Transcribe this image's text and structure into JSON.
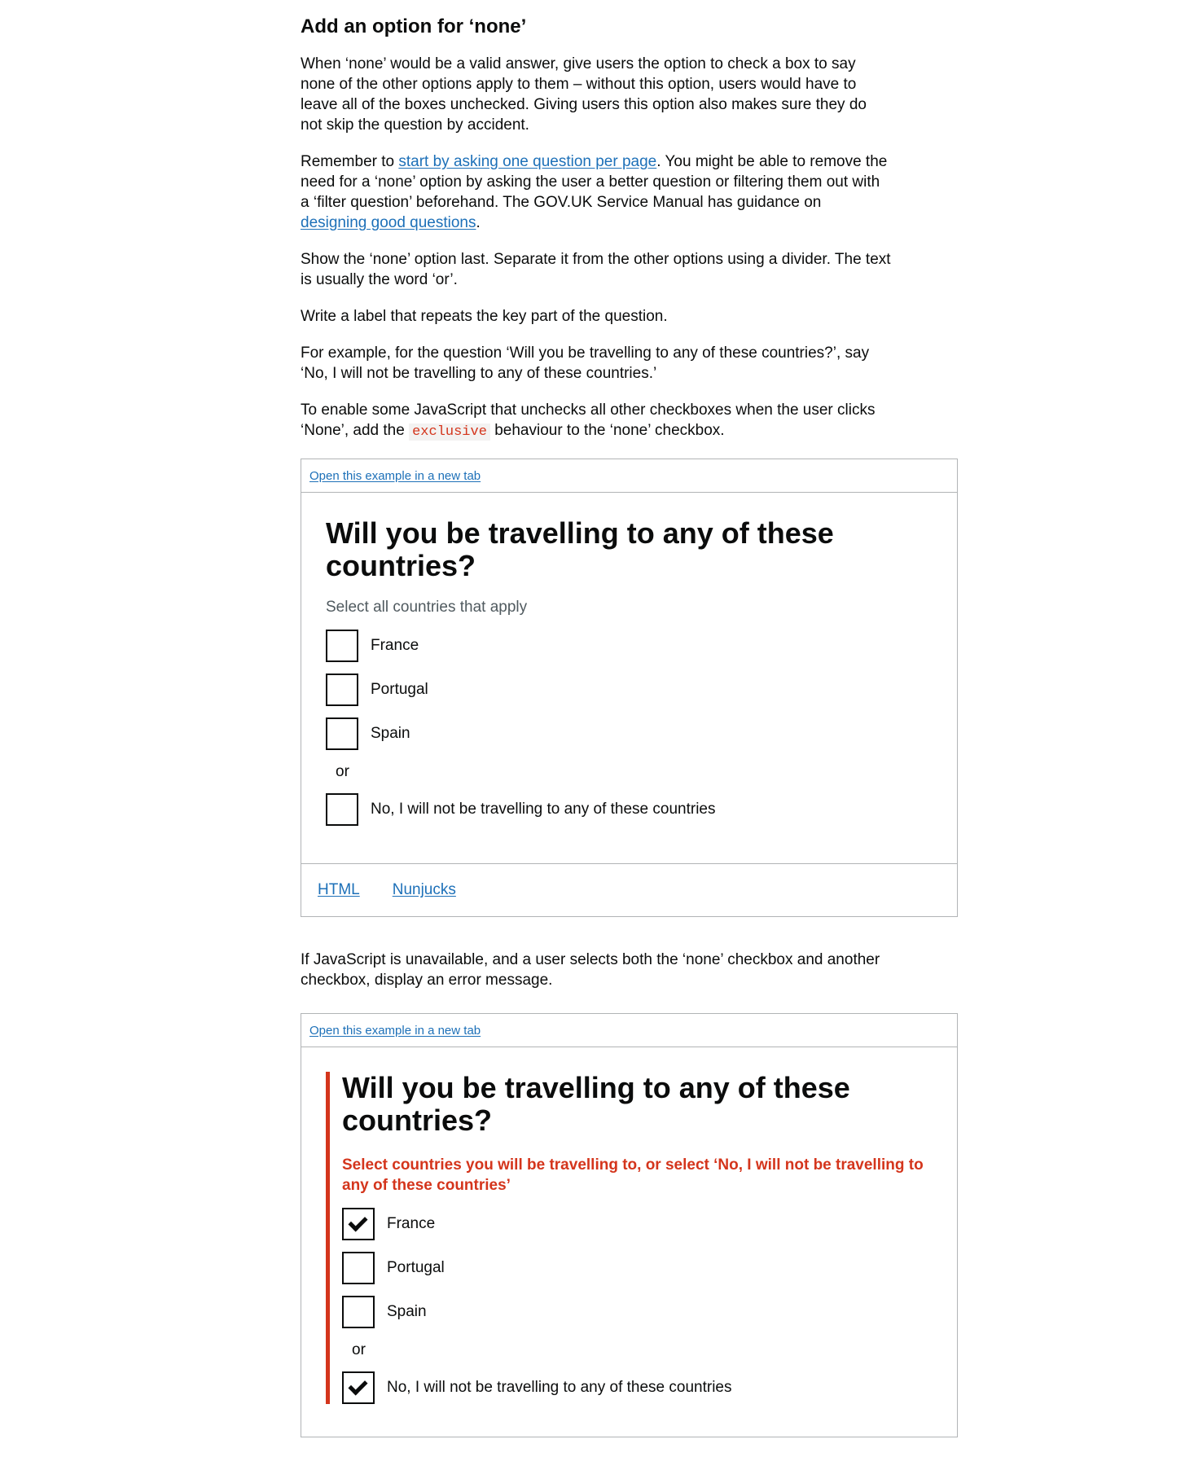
{
  "section_title": "Add an option for ‘none’",
  "p1": "When ‘none’ would be a valid answer, give users the option to check a box to say none of the other options apply to them – without this option, users would have to leave all of the boxes unchecked. Giving users this option also makes sure they do not skip the question by accident.",
  "p2": {
    "before": "Remember to ",
    "link1": "start by asking one question per page",
    "middle": ". You might be able to remove the need for a ‘none’ option by asking the user a better question or filtering them out with a ‘filter question’ beforehand. The GOV.UK Service Manual has guidance on ",
    "link2": "designing good questions",
    "after": "."
  },
  "p3": "Show the ‘none’ option last. Separate it from the other options using a divider. The text is usually the word ‘or’.",
  "p4": "Write a label that repeats the key part of the question.",
  "p5": "For example, for the question ‘Will you be travelling to any of these countries?’, say ‘No, I will not be travelling to any of these countries.’",
  "p6": {
    "before": "To enable some JavaScript that unchecks all other checkboxes when the user clicks ‘None’, add the ",
    "code": "exclusive",
    "after": " behaviour to the ‘none’ checkbox."
  },
  "example1": {
    "open_link": "Open this example in a new tab",
    "question": "Will you be travelling to any of these countries?",
    "hint": "Select all countries that apply",
    "options": [
      {
        "label": "France",
        "checked": false
      },
      {
        "label": "Portugal",
        "checked": false
      },
      {
        "label": "Spain",
        "checked": false
      }
    ],
    "divider": "or",
    "none_option": {
      "label": "No, I will not be travelling to any of these countries",
      "checked": false
    },
    "tabs": [
      "HTML",
      "Nunjucks"
    ]
  },
  "p7": "If JavaScript is unavailable, and a user selects both the ‘none’ checkbox and another checkbox, display an error message.",
  "example2": {
    "open_link": "Open this example in a new tab",
    "question": "Will you be travelling to any of these countries?",
    "error": "Select countries you will be travelling to, or select ‘No, I will not be travelling to any of these countries’",
    "options": [
      {
        "label": "France",
        "checked": true
      },
      {
        "label": "Portugal",
        "checked": false
      },
      {
        "label": "Spain",
        "checked": false
      }
    ],
    "divider": "or",
    "none_option": {
      "label": "No, I will not be travelling to any of these countries",
      "checked": true
    }
  },
  "colors": {
    "link": "#1d70b8",
    "error": "#d4351c",
    "text": "#0b0c0c",
    "hint": "#505a5f",
    "border": "#b1b4b6"
  }
}
